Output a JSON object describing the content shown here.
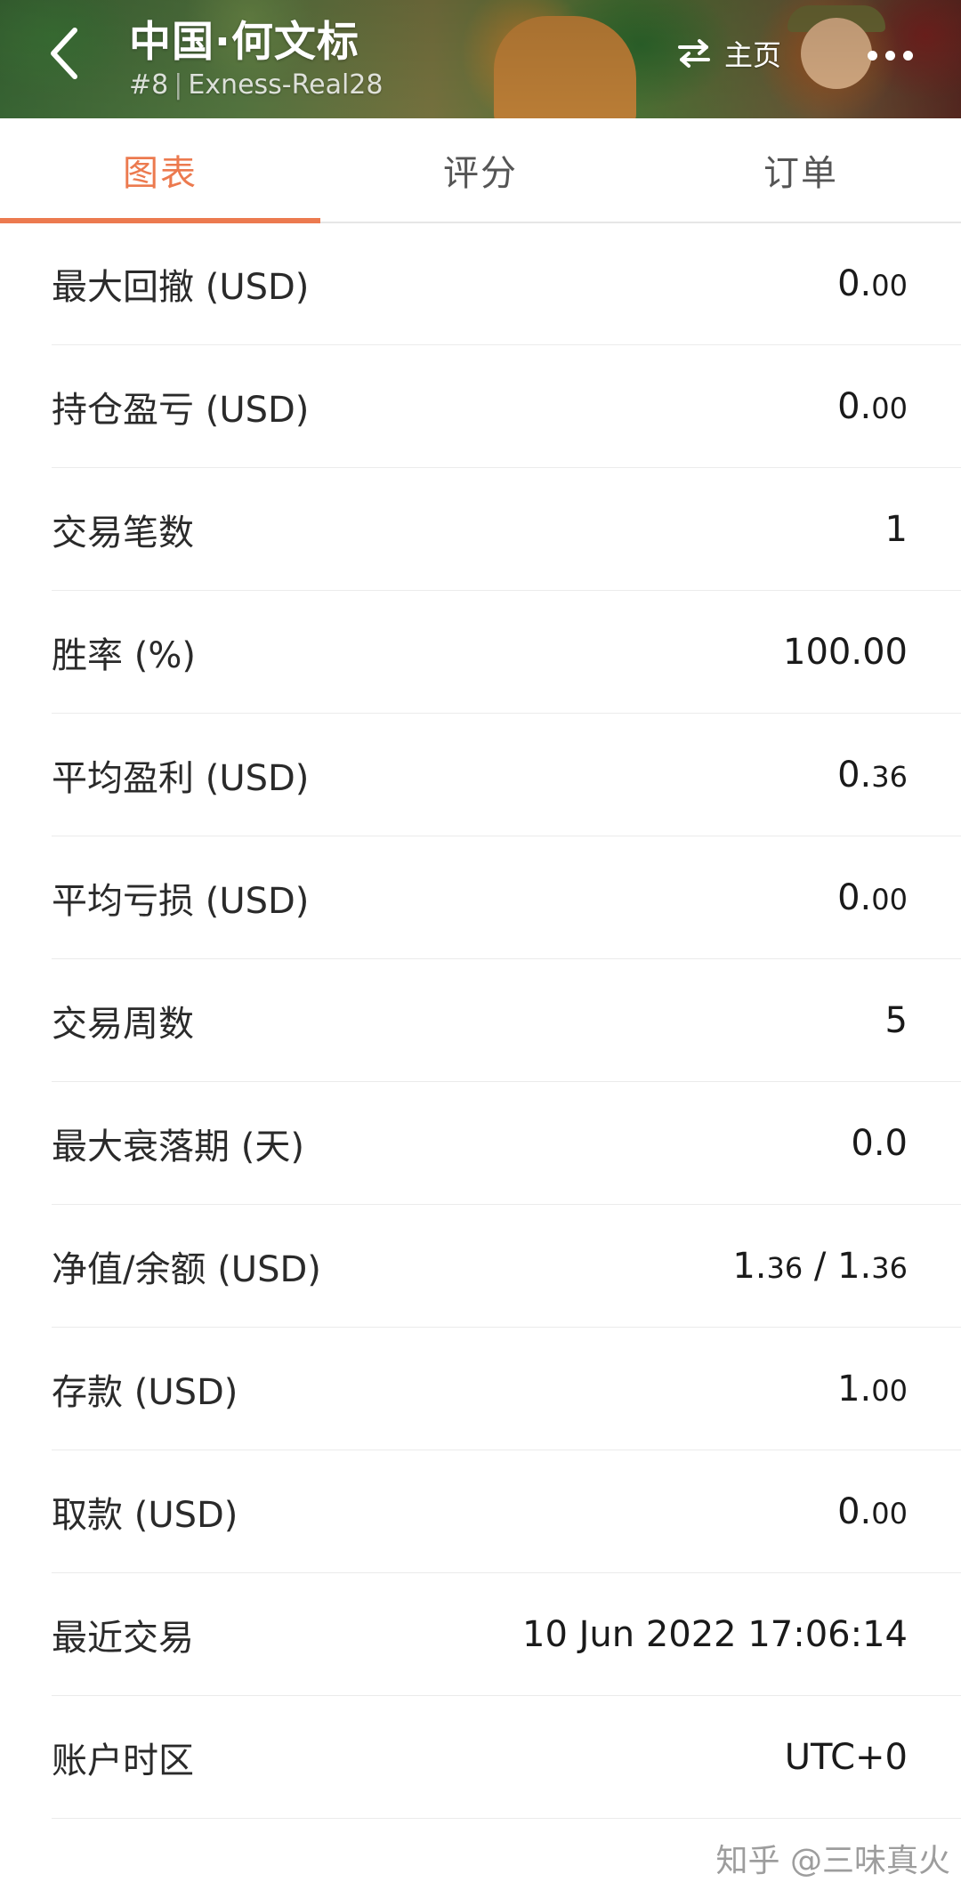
{
  "header": {
    "title": "中国·何文标",
    "rank": "#8",
    "account": "Exness-Real28",
    "home_label": "主页",
    "icons": {
      "back": "chevron-left-icon",
      "swap": "swap-arrows-icon",
      "more": "more-dots-icon"
    }
  },
  "tabs": [
    {
      "label": "图表",
      "active": true
    },
    {
      "label": "评分",
      "active": false
    },
    {
      "label": "订单",
      "active": false
    }
  ],
  "stats": [
    {
      "label": "最大回撤 (USD)",
      "value_main": "0.",
      "value_small": "00"
    },
    {
      "label": "持仓盈亏 (USD)",
      "value_main": "0.",
      "value_small": "00"
    },
    {
      "label": "交易笔数",
      "value_main": "1",
      "value_small": ""
    },
    {
      "label": "胜率 (%)",
      "value_main": "100.00",
      "value_small": ""
    },
    {
      "label": "平均盈利 (USD)",
      "value_main": "0.",
      "value_small": "36"
    },
    {
      "label": "平均亏损 (USD)",
      "value_main": "0.",
      "value_small": "00"
    },
    {
      "label": "交易周数",
      "value_main": "5",
      "value_small": ""
    },
    {
      "label": "最大衰落期 (天)",
      "value_main": "0.0",
      "value_small": ""
    },
    {
      "label": "净值/余额 (USD)",
      "value_main": "1.",
      "value_small": "36",
      "value_main_2": " / 1.",
      "value_small_2": "36"
    },
    {
      "label": "存款 (USD)",
      "value_main": "1.",
      "value_small": "00"
    },
    {
      "label": "取款 (USD)",
      "value_main": "0.",
      "value_small": "00"
    },
    {
      "label": "最近交易",
      "value_main": "10 Jun 2022 17:06:14",
      "value_small": ""
    },
    {
      "label": "账户时区",
      "value_main": "UTC+0",
      "value_small": ""
    }
  ],
  "watermark": "知乎 @三味真火",
  "colors": {
    "accent": "#ec7a4f",
    "divider": "#ebebeb",
    "text": "#2a2a2a"
  }
}
